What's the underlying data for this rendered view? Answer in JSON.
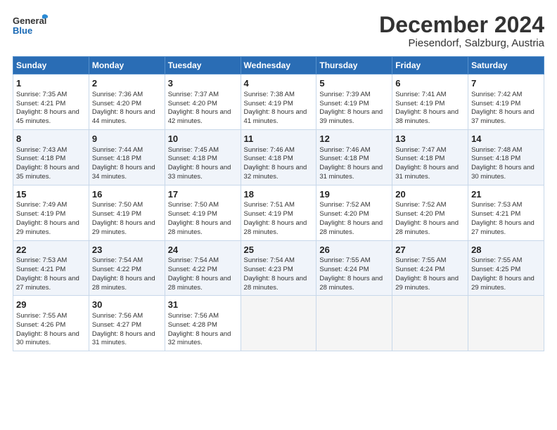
{
  "header": {
    "logo_line1": "General",
    "logo_line2": "Blue",
    "month": "December 2024",
    "location": "Piesendorf, Salzburg, Austria"
  },
  "days_of_week": [
    "Sunday",
    "Monday",
    "Tuesday",
    "Wednesday",
    "Thursday",
    "Friday",
    "Saturday"
  ],
  "weeks": [
    [
      {
        "day": "1",
        "sunrise": "7:35 AM",
        "sunset": "4:21 PM",
        "daylight": "8 hours and 45 minutes."
      },
      {
        "day": "2",
        "sunrise": "7:36 AM",
        "sunset": "4:20 PM",
        "daylight": "8 hours and 44 minutes."
      },
      {
        "day": "3",
        "sunrise": "7:37 AM",
        "sunset": "4:20 PM",
        "daylight": "8 hours and 42 minutes."
      },
      {
        "day": "4",
        "sunrise": "7:38 AM",
        "sunset": "4:19 PM",
        "daylight": "8 hours and 41 minutes."
      },
      {
        "day": "5",
        "sunrise": "7:39 AM",
        "sunset": "4:19 PM",
        "daylight": "8 hours and 39 minutes."
      },
      {
        "day": "6",
        "sunrise": "7:41 AM",
        "sunset": "4:19 PM",
        "daylight": "8 hours and 38 minutes."
      },
      {
        "day": "7",
        "sunrise": "7:42 AM",
        "sunset": "4:19 PM",
        "daylight": "8 hours and 37 minutes."
      }
    ],
    [
      {
        "day": "8",
        "sunrise": "7:43 AM",
        "sunset": "4:18 PM",
        "daylight": "8 hours and 35 minutes."
      },
      {
        "day": "9",
        "sunrise": "7:44 AM",
        "sunset": "4:18 PM",
        "daylight": "8 hours and 34 minutes."
      },
      {
        "day": "10",
        "sunrise": "7:45 AM",
        "sunset": "4:18 PM",
        "daylight": "8 hours and 33 minutes."
      },
      {
        "day": "11",
        "sunrise": "7:46 AM",
        "sunset": "4:18 PM",
        "daylight": "8 hours and 32 minutes."
      },
      {
        "day": "12",
        "sunrise": "7:46 AM",
        "sunset": "4:18 PM",
        "daylight": "8 hours and 31 minutes."
      },
      {
        "day": "13",
        "sunrise": "7:47 AM",
        "sunset": "4:18 PM",
        "daylight": "8 hours and 31 minutes."
      },
      {
        "day": "14",
        "sunrise": "7:48 AM",
        "sunset": "4:18 PM",
        "daylight": "8 hours and 30 minutes."
      }
    ],
    [
      {
        "day": "15",
        "sunrise": "7:49 AM",
        "sunset": "4:19 PM",
        "daylight": "8 hours and 29 minutes."
      },
      {
        "day": "16",
        "sunrise": "7:50 AM",
        "sunset": "4:19 PM",
        "daylight": "8 hours and 29 minutes."
      },
      {
        "day": "17",
        "sunrise": "7:50 AM",
        "sunset": "4:19 PM",
        "daylight": "8 hours and 28 minutes."
      },
      {
        "day": "18",
        "sunrise": "7:51 AM",
        "sunset": "4:19 PM",
        "daylight": "8 hours and 28 minutes."
      },
      {
        "day": "19",
        "sunrise": "7:52 AM",
        "sunset": "4:20 PM",
        "daylight": "8 hours and 28 minutes."
      },
      {
        "day": "20",
        "sunrise": "7:52 AM",
        "sunset": "4:20 PM",
        "daylight": "8 hours and 28 minutes."
      },
      {
        "day": "21",
        "sunrise": "7:53 AM",
        "sunset": "4:21 PM",
        "daylight": "8 hours and 27 minutes."
      }
    ],
    [
      {
        "day": "22",
        "sunrise": "7:53 AM",
        "sunset": "4:21 PM",
        "daylight": "8 hours and 27 minutes."
      },
      {
        "day": "23",
        "sunrise": "7:54 AM",
        "sunset": "4:22 PM",
        "daylight": "8 hours and 28 minutes."
      },
      {
        "day": "24",
        "sunrise": "7:54 AM",
        "sunset": "4:22 PM",
        "daylight": "8 hours and 28 minutes."
      },
      {
        "day": "25",
        "sunrise": "7:54 AM",
        "sunset": "4:23 PM",
        "daylight": "8 hours and 28 minutes."
      },
      {
        "day": "26",
        "sunrise": "7:55 AM",
        "sunset": "4:24 PM",
        "daylight": "8 hours and 28 minutes."
      },
      {
        "day": "27",
        "sunrise": "7:55 AM",
        "sunset": "4:24 PM",
        "daylight": "8 hours and 29 minutes."
      },
      {
        "day": "28",
        "sunrise": "7:55 AM",
        "sunset": "4:25 PM",
        "daylight": "8 hours and 29 minutes."
      }
    ],
    [
      {
        "day": "29",
        "sunrise": "7:55 AM",
        "sunset": "4:26 PM",
        "daylight": "8 hours and 30 minutes."
      },
      {
        "day": "30",
        "sunrise": "7:56 AM",
        "sunset": "4:27 PM",
        "daylight": "8 hours and 31 minutes."
      },
      {
        "day": "31",
        "sunrise": "7:56 AM",
        "sunset": "4:28 PM",
        "daylight": "8 hours and 32 minutes."
      },
      null,
      null,
      null,
      null
    ]
  ],
  "labels": {
    "sunrise": "Sunrise:",
    "sunset": "Sunset:",
    "daylight": "Daylight:"
  }
}
